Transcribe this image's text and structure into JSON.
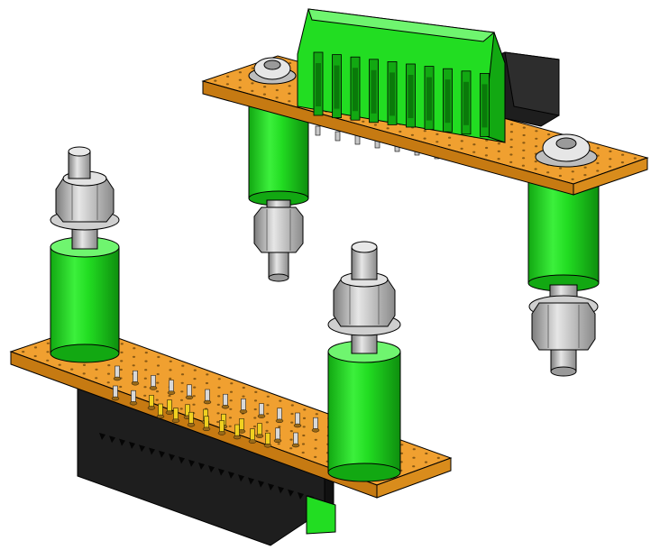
{
  "scene": {
    "description_visible_text": "",
    "objects": [
      {
        "name": "upper-board-assembly",
        "parts": [
          "orange-perfboard",
          "green-terminal-block-10-way",
          "black-connector-body",
          "green-standoffs",
          "steel-screws",
          "steel-nuts"
        ]
      },
      {
        "name": "lower-board-assembly",
        "parts": [
          "orange-perfboard",
          "black-dsub-connector",
          "gold-pins",
          "green-standoffs",
          "steel-bolts",
          "steel-nuts"
        ]
      }
    ],
    "colors": {
      "background": "#ffffff",
      "board": "#f0a030",
      "board_dark": "#c67a12",
      "hole": "#8a5a14",
      "green": "#22dd22",
      "green_dark": "#12a812",
      "green_light": "#6ff56f",
      "steel": "#c8c8c8",
      "steel_dark": "#7c7c7c",
      "steel_light": "#efefef",
      "black": "#1e1e1e",
      "black_light": "#3a3a3a",
      "gold": "#f0d020",
      "outline": "#000000"
    }
  }
}
